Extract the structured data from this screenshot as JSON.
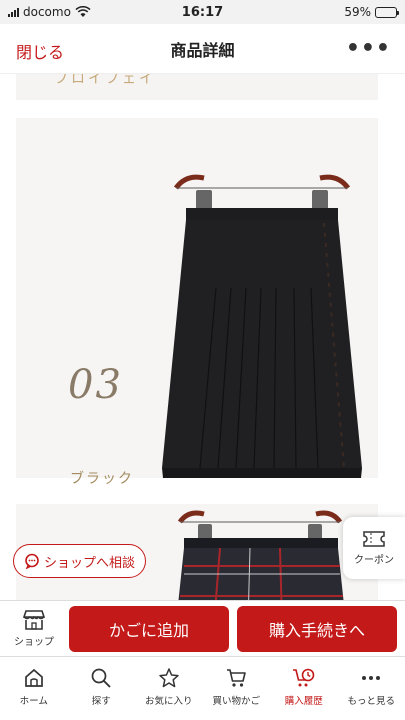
{
  "status_bar": {
    "carrier": "docomo",
    "time": "16:17",
    "battery": "59%",
    "battery_level": 0.59
  },
  "header": {
    "close_label": "閉じる",
    "title": "商品詳細",
    "more_label": "•••"
  },
  "product": {
    "top_variant_text": "フロイフェイ",
    "variant_number": "03",
    "variant_color": "ブラック"
  },
  "consult": {
    "label": "ショップへ相談"
  },
  "coupon": {
    "label": "クーポン"
  },
  "actions": {
    "shop_label": "ショップ",
    "add_to_cart": "かごに追加",
    "checkout": "購入手続きへ"
  },
  "tabs": [
    {
      "label": "ホーム",
      "icon": "home-icon"
    },
    {
      "label": "探す",
      "icon": "search-icon"
    },
    {
      "label": "お気に入り",
      "icon": "star-icon"
    },
    {
      "label": "買い物かご",
      "icon": "cart-icon"
    },
    {
      "label": "購入履歴",
      "icon": "history-icon",
      "active": true
    },
    {
      "label": "もっと見る",
      "icon": "more-icon"
    }
  ],
  "colors": {
    "accent": "#c41919",
    "panel": "#f6f5f3",
    "gold_text": "#a48c60"
  }
}
